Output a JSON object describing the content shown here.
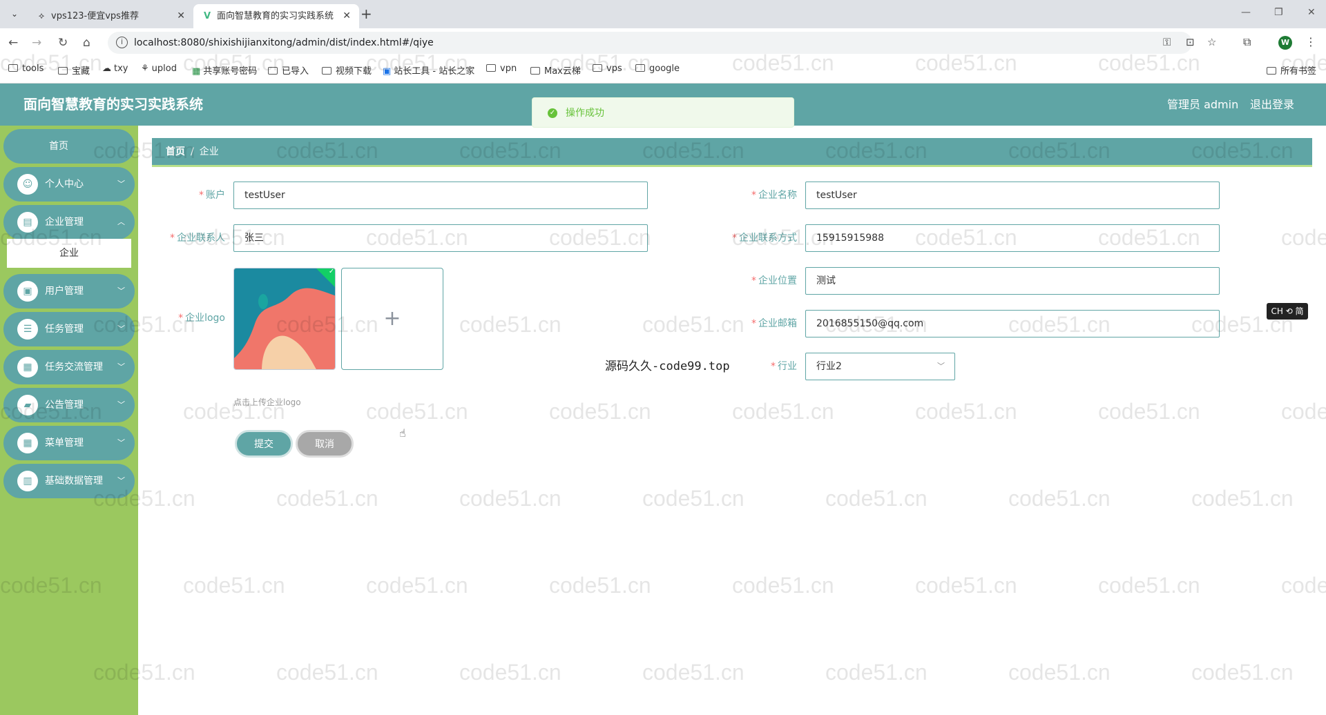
{
  "browser": {
    "tabs": [
      {
        "title": "vps123-便宜vps推荐",
        "active": false
      },
      {
        "title": "面向智慧教育的实习实践系统",
        "active": true
      }
    ],
    "url": "localhost:8080/shixishijianxitong/admin/dist/index.html#/qiye",
    "bookmarks": [
      "tools",
      "宝藏",
      "txy",
      "uplod",
      "共享账号密码",
      "已导入",
      "视频下载",
      "站长工具 - 站长之家",
      "vpn",
      "Max云梯",
      "vps",
      "google"
    ],
    "all_bookmarks": "所有书签",
    "profile_initial": "W"
  },
  "app": {
    "title": "面向智慧教育的实习实践系统",
    "admin_label": "管理员 admin",
    "logout_label": "退出登录",
    "toast": "操作成功"
  },
  "sidebar": {
    "items": [
      {
        "label": "首页"
      },
      {
        "label": "个人中心"
      },
      {
        "label": "企业管理"
      },
      {
        "label": "用户管理"
      },
      {
        "label": "任务管理"
      },
      {
        "label": "任务交流管理"
      },
      {
        "label": "公告管理"
      },
      {
        "label": "菜单管理"
      },
      {
        "label": "基础数据管理"
      }
    ],
    "submenu_label": "企业"
  },
  "breadcrumb": {
    "home": "首页",
    "separator": "/",
    "current": "企业"
  },
  "form": {
    "account": {
      "label": "账户",
      "value": "testUser"
    },
    "company_name": {
      "label": "企业名称",
      "value": "testUser"
    },
    "contact": {
      "label": "企业联系人",
      "value": "张三"
    },
    "contact_phone": {
      "label": "企业联系方式",
      "value": "15915915988"
    },
    "location": {
      "label": "企业位置",
      "value": "测试"
    },
    "logo": {
      "label": "企业logo",
      "hint": "点击上传企业logo"
    },
    "email": {
      "label": "企业邮箱",
      "value": "2016855150@qq.com"
    },
    "industry": {
      "label": "行业",
      "value": "行业2"
    },
    "submit_label": "提交",
    "cancel_label": "取消"
  },
  "overlay": {
    "source_text": "源码久久-code99.top",
    "watermark": "code51.cn",
    "ime_indicator": "CH ⟲ 简"
  },
  "colors": {
    "primary": "#5fa5a5",
    "sidebar": "#9bc85f",
    "required": "#f56c6c",
    "success": "#67c23a"
  }
}
